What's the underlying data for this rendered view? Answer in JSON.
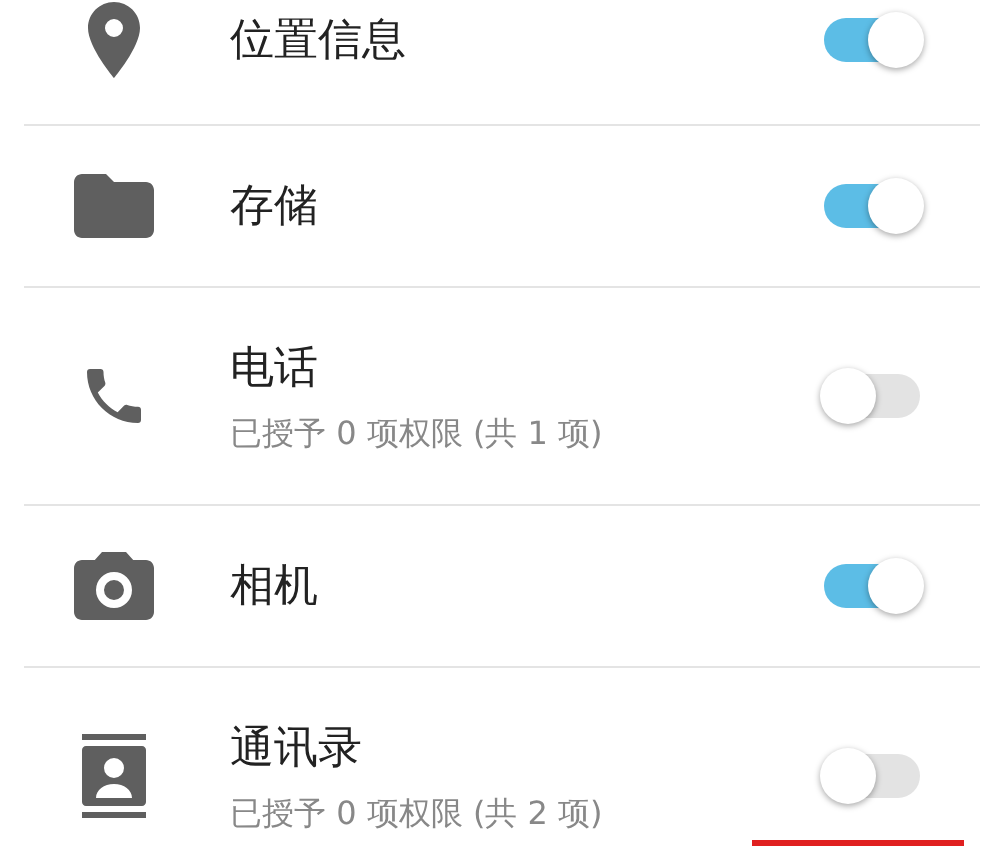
{
  "permissions": [
    {
      "kind": "pin",
      "title": "位置信息",
      "on": true
    },
    {
      "kind": "folder",
      "title": "存储",
      "on": true
    },
    {
      "kind": "phone",
      "title": "电话",
      "subtitle": "已授予 0 项权限 (共 1 项)",
      "on": false
    },
    {
      "kind": "camera",
      "title": "相机",
      "on": true
    },
    {
      "kind": "contact",
      "title": "通讯录",
      "subtitle": "已授予 0 项权限 (共 2 项)",
      "on": false
    }
  ]
}
